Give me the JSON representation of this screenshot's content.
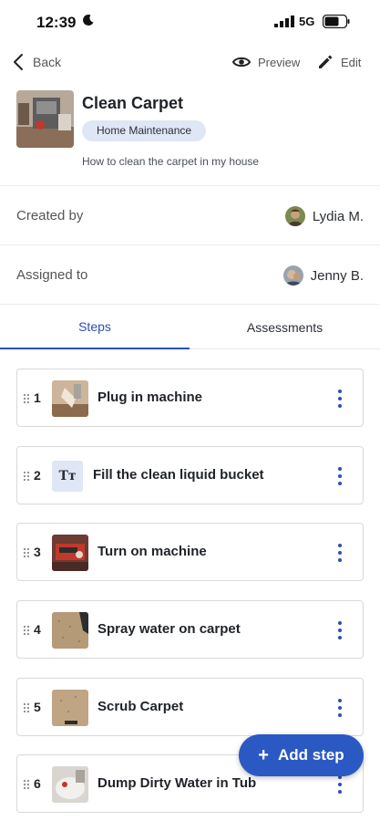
{
  "status_bar": {
    "time": "12:39",
    "network": "5G"
  },
  "nav": {
    "back_label": "Back",
    "preview_label": "Preview",
    "edit_label": "Edit"
  },
  "task": {
    "title": "Clean Carpet",
    "category": "Home Maintenance",
    "description": "How to clean the carpet in my house"
  },
  "info": {
    "created_by_label": "Created by",
    "created_by_name": "Lydia M.",
    "assigned_to_label": "Assigned to",
    "assigned_to_name": "Jenny B."
  },
  "tabs": [
    {
      "label": "Steps",
      "active": true
    },
    {
      "label": "Assessments",
      "active": false
    }
  ],
  "steps": [
    {
      "number": "1",
      "title": "Plug in machine",
      "icon": "photo-thumbnail"
    },
    {
      "number": "2",
      "title": "Fill the clean liquid bucket",
      "icon": "text-format-icon",
      "icon_glyph": "Tт"
    },
    {
      "number": "3",
      "title": "Turn on machine",
      "icon": "photo-thumbnail"
    },
    {
      "number": "4",
      "title": "Spray water on carpet",
      "icon": "photo-thumbnail"
    },
    {
      "number": "5",
      "title": "Scrub Carpet",
      "icon": "photo-thumbnail"
    },
    {
      "number": "6",
      "title": "Dump Dirty Water in Tub",
      "icon": "photo-thumbnail"
    }
  ],
  "fab": {
    "plus": "+",
    "label": "Add step"
  },
  "colors": {
    "accent": "#2b59c3",
    "tab_active": "#2a4fb8",
    "badge_bg": "#dfe6f5"
  }
}
